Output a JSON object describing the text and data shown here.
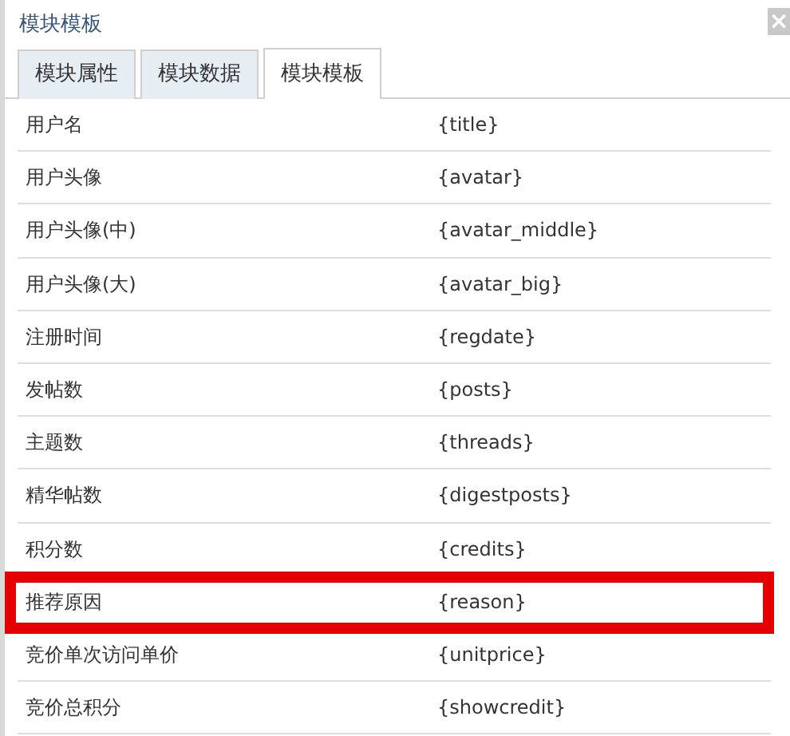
{
  "window": {
    "title": "模块模板",
    "close": "×"
  },
  "tabs": [
    {
      "label": "模块属性",
      "selected": false
    },
    {
      "label": "模块数据",
      "selected": false
    },
    {
      "label": "模块模板",
      "selected": true
    }
  ],
  "table": {
    "rows": [
      {
        "name": "用户名",
        "tag": "{title}",
        "highlighted": false
      },
      {
        "name": "用户头像",
        "tag": "{avatar}",
        "highlighted": false
      },
      {
        "name": "用户头像(中)",
        "tag": "{avatar_middle}",
        "highlighted": false
      },
      {
        "name": "用户头像(大)",
        "tag": "{avatar_big}",
        "highlighted": false
      },
      {
        "name": "注册时间",
        "tag": "{regdate}",
        "highlighted": false
      },
      {
        "name": "发帖数",
        "tag": "{posts}",
        "highlighted": false
      },
      {
        "name": "主题数",
        "tag": "{threads}",
        "highlighted": false
      },
      {
        "name": "精华帖数",
        "tag": "{digestposts}",
        "highlighted": false
      },
      {
        "name": "积分数",
        "tag": "{credits}",
        "highlighted": false
      },
      {
        "name": "推荐原因",
        "tag": "{reason}",
        "highlighted": true
      },
      {
        "name": "竞价单次访问单价",
        "tag": "{unitprice}",
        "highlighted": false
      },
      {
        "name": "竞价总积分",
        "tag": "{showcredit}",
        "highlighted": false
      }
    ]
  }
}
